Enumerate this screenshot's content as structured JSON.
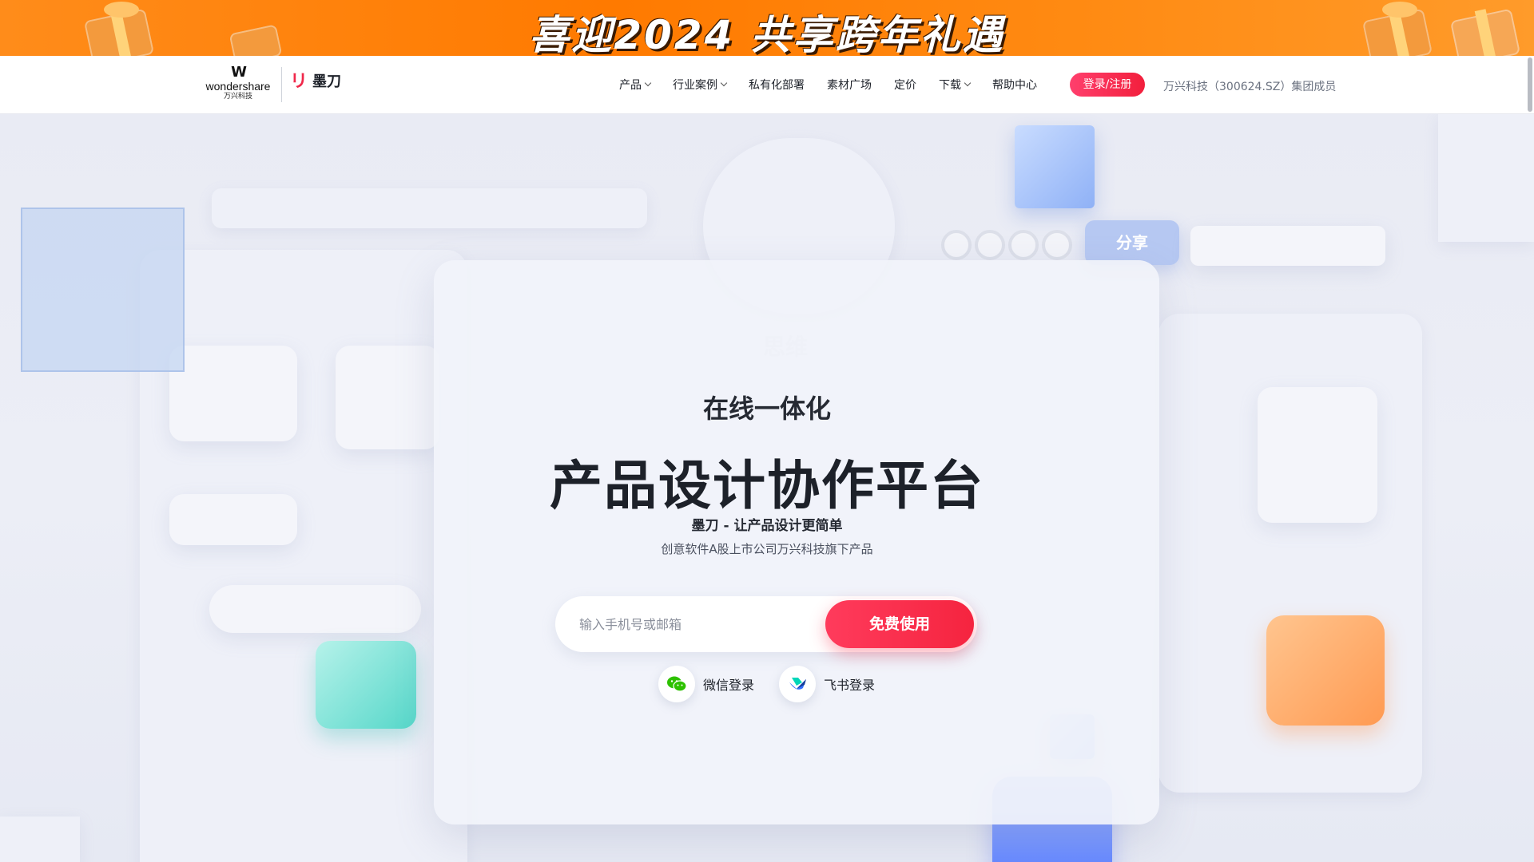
{
  "banner": {
    "text": "喜迎2024 共享跨年礼遇"
  },
  "nav": {
    "brand_parent_mark": "W",
    "brand_parent": "wondershare",
    "brand_parent_cn": "万兴科技",
    "brand_mark": "リ",
    "brand": "墨刀",
    "menu": [
      {
        "label": "产品",
        "has_dropdown": true
      },
      {
        "label": "行业案例",
        "has_dropdown": true
      },
      {
        "label": "私有化部署",
        "has_dropdown": false
      },
      {
        "label": "素材广场",
        "has_dropdown": false
      },
      {
        "label": "定价",
        "has_dropdown": false
      },
      {
        "label": "下载",
        "has_dropdown": true
      },
      {
        "label": "帮助中心",
        "has_dropdown": false
      }
    ],
    "login_label": "登录/注册",
    "group_text": "万兴科技（300624.SZ）集团成员"
  },
  "hero": {
    "subtitle": "在线一体化",
    "title": "产品设计协作平台",
    "tagline": "墨刀 - 让产品设计更简单",
    "description": "创意软件A股上市公司万兴科技旗下产品",
    "input_placeholder": "输入手机号或邮箱",
    "cta_label": "免费使用",
    "wechat_login": "微信登录",
    "feishu_login": "飞书登录"
  },
  "decor": {
    "share_label": "分享",
    "mindmap_label": "思维"
  },
  "colors": {
    "accent": "#f5243f",
    "banner": "#ff7a00",
    "text": "#1d2129"
  }
}
